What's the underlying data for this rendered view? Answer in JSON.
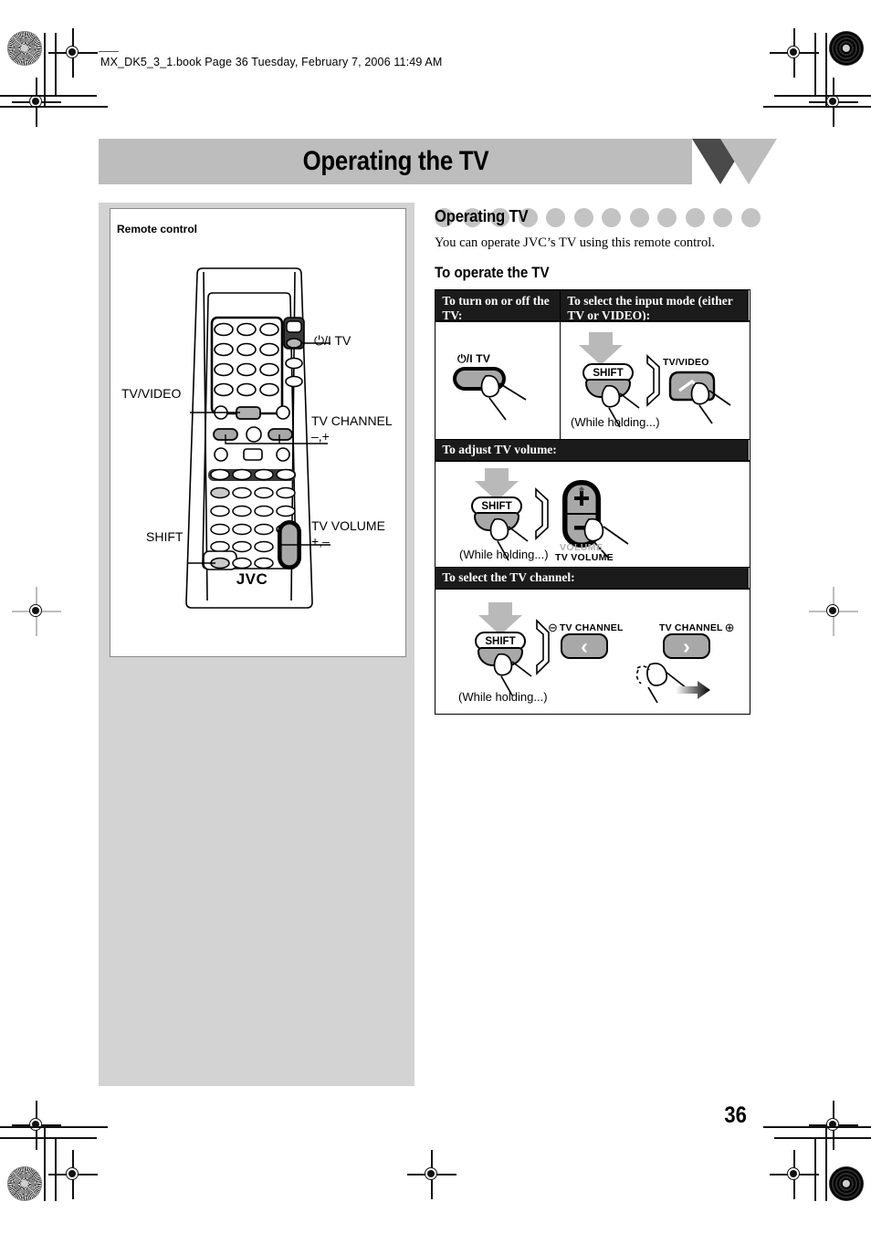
{
  "page": {
    "file_header": "MX_DK5_3_1.book  Page 36  Tuesday, February 7, 2006  11:49 AM",
    "number": "36",
    "banner_title": "Operating the TV"
  },
  "left_panel": {
    "caption": "Remote control",
    "brand": "JVC",
    "callouts": {
      "power": "⏻/I TV",
      "tv_video": "TV/VIDEO",
      "tv_channel": "TV CHANNEL",
      "tv_channel_sub": "–,+",
      "tv_volume": "TV VOLUME",
      "tv_volume_sub": "+,–",
      "shift": "SHIFT"
    }
  },
  "right_panel": {
    "section_heading": "Operating TV",
    "intro": "You can operate JVC’s TV using this remote control.",
    "sub_heading": "To operate the TV",
    "dot_count": 9,
    "table": {
      "row1": {
        "col1_header": "To turn on or off the TV:",
        "col2_header": "To select the input mode (either TV or VIDEO):",
        "col1_button_label": "⏻/I TV",
        "col2_shift_label": "SHIFT",
        "col2_while_holding": "(While holding...)",
        "col2_button_label": "TV/VIDEO"
      },
      "row2": {
        "header": "To adjust TV volume:",
        "shift_label": "SHIFT",
        "while_holding": "(While holding...)",
        "volume_gray_label": "VOLUME",
        "volume_black_label": "TV VOLUME",
        "plus": "+",
        "minus": "–"
      },
      "row3": {
        "header": "To select the TV channel:",
        "shift_label": "SHIFT",
        "while_holding": "(While holding...)",
        "minus_label": "TV CHANNEL",
        "minus_symbol": "⊖",
        "plus_label": "TV CHANNEL",
        "plus_symbol": "⊕",
        "left_chevron": "‹",
        "right_chevron": "›"
      }
    }
  },
  "colors": {
    "banner_gray": "#bdbdbd",
    "column_gray": "#d3d3d3",
    "header_black": "#1b1b1b",
    "button_gray": "#a8a8a8",
    "dot_gray": "#c3c3c3",
    "arrow_gray": "#b9b9b9"
  }
}
